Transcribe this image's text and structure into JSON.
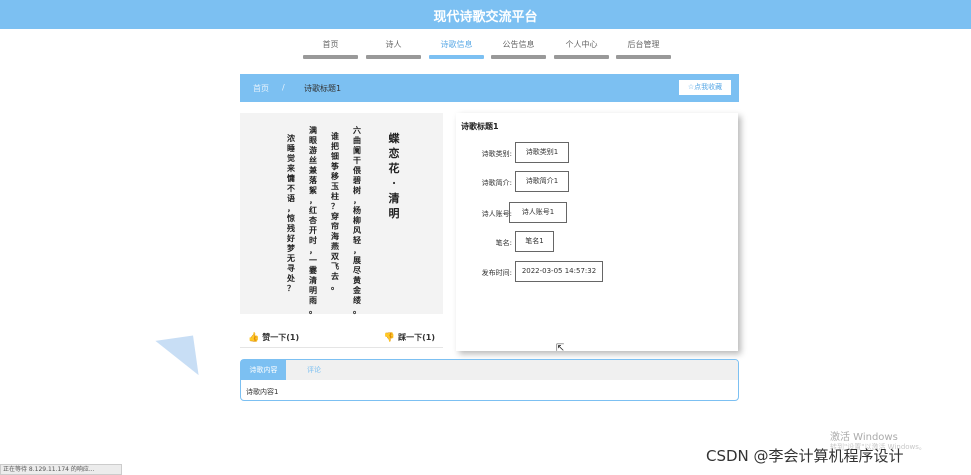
{
  "header": {
    "title": "现代诗歌交流平台"
  },
  "nav": {
    "items": [
      {
        "label": "首页",
        "active": false
      },
      {
        "label": "诗人",
        "active": false
      },
      {
        "label": "诗歌信息",
        "active": true
      },
      {
        "label": "公告信息",
        "active": false
      },
      {
        "label": "个人中心",
        "active": false
      },
      {
        "label": "后台管理",
        "active": false
      }
    ]
  },
  "breadcrumb": {
    "home": "首页",
    "separator": "/",
    "current": "诗歌标题1"
  },
  "favorite": {
    "icon": "star-icon",
    "label": "点我收藏"
  },
  "poem_image": {
    "columns": [
      "蝶恋花·清明",
      "六曲阑干偎碧树，杨柳风轻，展尽黄金缕。",
      "谁把钿筝移玉柱？穿帘海燕双飞去。",
      "满眼游丝兼落絮，红杏开时，一霎清明雨。",
      "浓睡觉来慵不语，惊残好梦无寻处？"
    ]
  },
  "reactions": {
    "like_label": "赞一下(1)",
    "dislike_label": "踩一下(1)"
  },
  "detail": {
    "title": "诗歌标题1",
    "fields": [
      {
        "label": "诗歌类别:",
        "value": "诗歌类别1"
      },
      {
        "label": "诗歌简介:",
        "value": "诗歌简介1"
      },
      {
        "label": "诗人账号:",
        "value": "诗人账号1"
      },
      {
        "label": "笔名:",
        "value": "笔名1"
      },
      {
        "label": "发布时间:",
        "value": "2022-03-05 14:57:32"
      }
    ]
  },
  "tabs": {
    "items": [
      {
        "label": "诗歌内容",
        "active": true
      },
      {
        "label": "评论",
        "active": false
      }
    ],
    "content": "诗歌内容1"
  },
  "watermark": {
    "windows": "激活 Windows",
    "windows_sub": "转到\"设置\"以激活 Windows。",
    "csdn": "CSDN @李会计算机程序设计"
  },
  "status": {
    "text": "正在等待 8.129.11.174 的响应..."
  }
}
